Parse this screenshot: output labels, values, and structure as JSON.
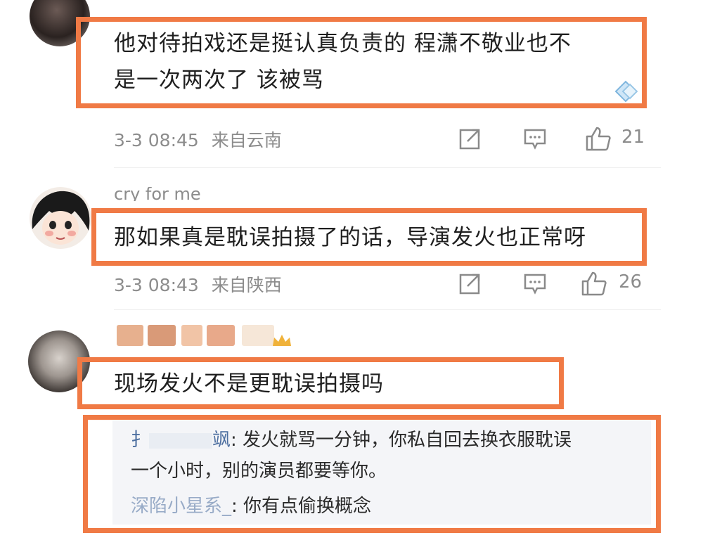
{
  "comments": [
    {
      "text_line1": "他对待拍戏还是挺认真负责的 程潇不敬业也不",
      "text_line2": "是一次两次了 该被骂",
      "time": "3-3 08:45",
      "location": "来自云南",
      "likes": "21"
    },
    {
      "username": "cry for me",
      "text_line1": "那如果真是耽误拍摄了的话，导演发火也正常呀",
      "time": "3-3 08:43",
      "location": "来自陕西",
      "likes": "26"
    },
    {
      "text_line1": "现场发火不是更耽误拍摄吗",
      "replies": [
        {
          "name_visible": "扌",
          "name_tail": "飒",
          "text": ": 发火就骂一分钟，你私自回去换衣服耽误",
          "text_cont": "一个小时，别的演员都要等你。"
        },
        {
          "name": "深陷小星系_",
          "text": ": 你有点偷换概念"
        }
      ]
    }
  ],
  "colors": {
    "highlight": "#f07a45",
    "meta_gray": "#8c8c8c",
    "reply_bg": "#f4f5f8",
    "reply_name": "#4d6fa0"
  },
  "icons": [
    "share-icon",
    "comment-icon",
    "like-icon"
  ]
}
